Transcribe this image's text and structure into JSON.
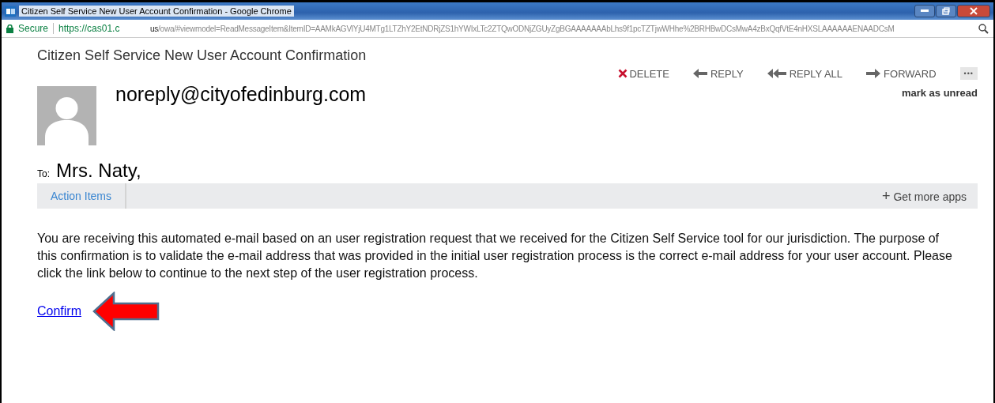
{
  "window": {
    "title": "Citizen Self Service New User Account Confirmation - Google Chrome"
  },
  "address_bar": {
    "security": "Secure",
    "url_start": "https://cas01.c",
    "url_rest": "us/owa/#viewmodel=ReadMessageItem&ItemID=AAMkAGVlYjU4MTg1LTZhY2EtNDRjZS1hYWIxLTc2ZTQwODNjZGUyZgBGAAAAAAAbLhs9f1pcTZTjwWHhe%2BRHBwDCsMwA4zBxQqfVtE4nHXSLAAAAAAENAADCsM"
  },
  "message": {
    "subject": "Citizen Self Service New User Account Confirmation",
    "actions": [
      {
        "kind": "delete",
        "label": "DELETE"
      },
      {
        "kind": "reply",
        "label": "REPLY"
      },
      {
        "kind": "reply_all",
        "label": "REPLY ALL"
      },
      {
        "kind": "forward",
        "label": "FORWARD"
      },
      {
        "kind": "more",
        "label": "•••"
      }
    ],
    "mark_unread": "mark as unread",
    "sender": "noreply@cityofedinburg.com",
    "to_label": "To:",
    "to": "Mrs. Naty,",
    "apps_bar": {
      "tab": "Action Items",
      "more_apps_icon": "+",
      "more_apps": "Get more apps"
    },
    "body": "You are receiving this automated e-mail based on an user registration request that we received for the Citizen Self Service tool for our jurisdiction. The purpose of this confirmation is to validate the e-mail address that was provided in the initial user registration process is the correct e-mail address for your user account. Please click the link below to continue to the next step of the user registration process.",
    "link": "Confirm"
  }
}
